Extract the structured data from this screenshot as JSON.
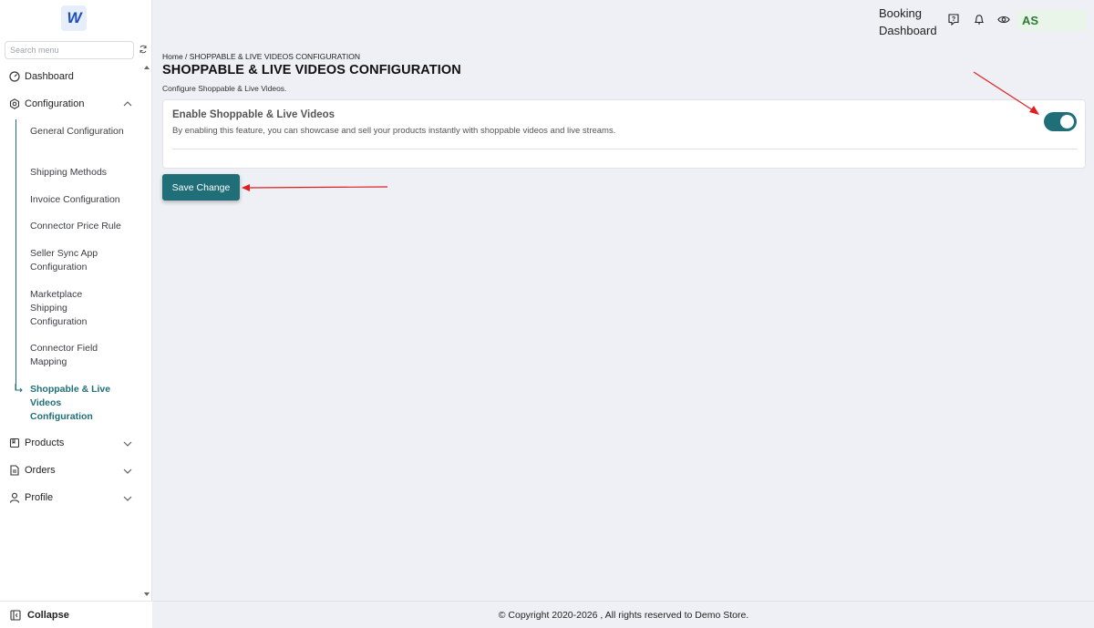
{
  "sidebar": {
    "logo_text": "W",
    "search_placeholder": "Search menu",
    "dashboard_label": "Dashboard",
    "configuration_label": "Configuration",
    "config_items": [
      {
        "label": "General Configuration"
      },
      {
        "label": "Shipping Methods"
      },
      {
        "label": "Invoice Configuration"
      },
      {
        "label": "Connector Price Rule"
      },
      {
        "label": "Seller Sync App Configuration"
      },
      {
        "label": "Marketplace Shipping Configuration"
      },
      {
        "label": "Connector Field Mapping"
      },
      {
        "label": "Shoppable & Live Videos Configuration",
        "active": true
      }
    ],
    "products_label": "Products",
    "orders_label": "Orders",
    "profile_label": "Profile",
    "collapse_label": "Collapse"
  },
  "header": {
    "title_line1": "Booking",
    "title_line2": "Dashboard",
    "avatar_initials": "AS"
  },
  "main": {
    "breadcrumb_home": "Home",
    "breadcrumb_sep": " / ",
    "breadcrumb_current": "SHOPPABLE & LIVE VIDEOS CONFIGURATION",
    "page_title": "SHOPPABLE & LIVE VIDEOS CONFIGURATION",
    "page_subtitle": "Configure Shoppable & Live Videos.",
    "setting": {
      "title": "Enable Shoppable & Live Videos",
      "description": "By enabling this feature, you can showcase and sell your products instantly with shoppable videos and live streams.",
      "enabled": true
    },
    "save_label": "Save Change"
  },
  "footer": {
    "text": "© Copyright 2020-2026 , All rights reserved to Demo Store."
  },
  "colors": {
    "accent": "#1f6e78",
    "annotation": "#e02020"
  }
}
